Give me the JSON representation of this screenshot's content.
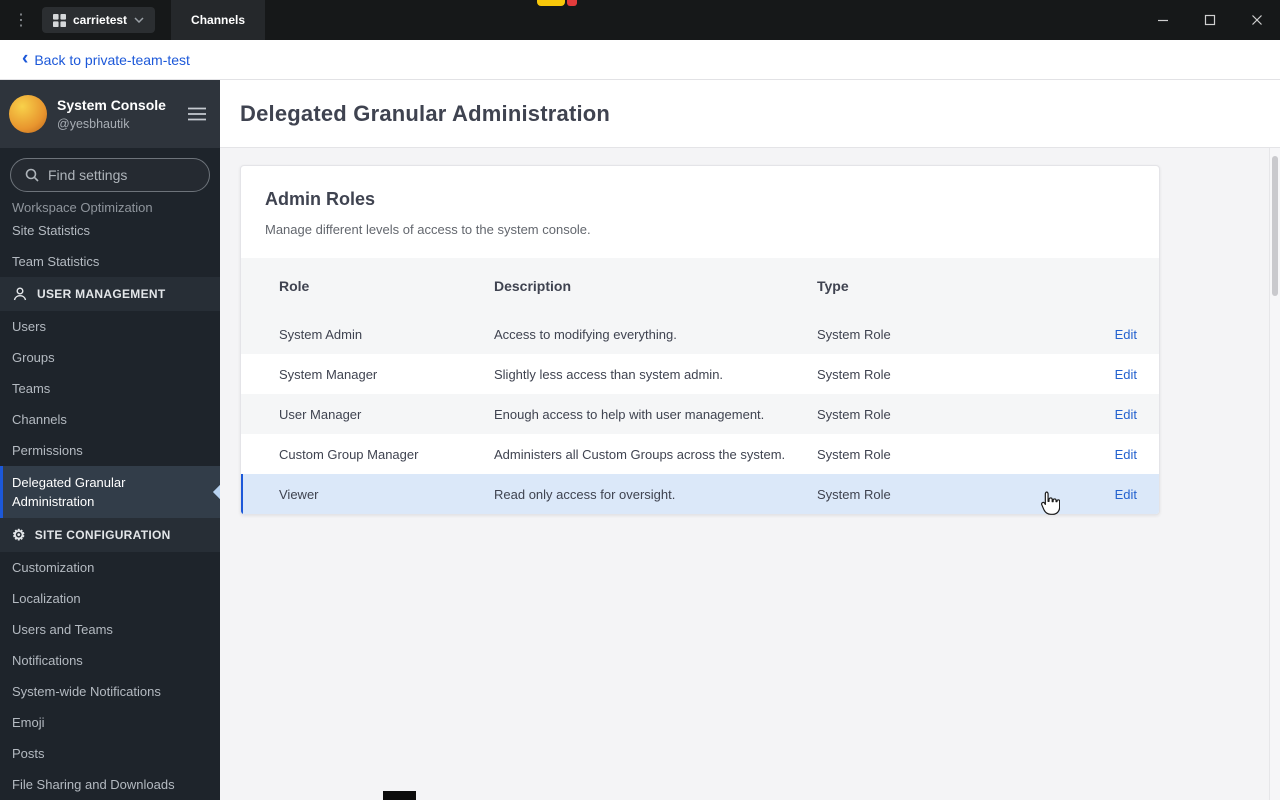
{
  "titlebar": {
    "server_name": "carrietest",
    "tab_label": "Channels"
  },
  "glyphs": {
    "menu_dots": "⋮",
    "back_chevron": "‹",
    "gear": "⚙"
  },
  "icons": [
    "menu-dots-icon",
    "server-grid-icon",
    "chevron-down-icon",
    "minimize-icon",
    "maximize-icon",
    "close-icon",
    "back-chevron-icon",
    "search-icon",
    "hamburger-menu-icon",
    "user-management-icon",
    "site-configuration-gear-icon",
    "active-item-pointer-icon",
    "hand-cursor-icon"
  ],
  "back_bar": {
    "label": "Back to private-team-test"
  },
  "sidebar": {
    "title": "System Console",
    "subtitle": "@yesbhautik",
    "search_placeholder": "Find settings",
    "top_items": [
      "Workspace Optimization",
      "Site Statistics",
      "Team Statistics"
    ],
    "sections": [
      {
        "label": "USER MANAGEMENT",
        "items": [
          "Users",
          "Groups",
          "Teams",
          "Channels",
          "Permissions",
          "Delegated Granular Administration"
        ]
      },
      {
        "label": "SITE CONFIGURATION",
        "items": [
          "Customization",
          "Localization",
          "Users and Teams",
          "Notifications",
          "System-wide Notifications",
          "Emoji",
          "Posts",
          "File Sharing and Downloads"
        ]
      }
    ],
    "active_item": "Delegated Granular Administration"
  },
  "main": {
    "page_title": "Delegated Granular Administration",
    "card": {
      "title": "Admin Roles",
      "subtitle": "Manage different levels of access to the system console.",
      "table": {
        "headers": {
          "role": "Role",
          "description": "Description",
          "type": "Type"
        },
        "edit_label": "Edit",
        "rows": [
          {
            "role": "System Admin",
            "description": "Access to modifying everything.",
            "type": "System Role"
          },
          {
            "role": "System Manager",
            "description": "Slightly less access than system admin.",
            "type": "System Role"
          },
          {
            "role": "User Manager",
            "description": "Enough access to help with user management.",
            "type": "System Role"
          },
          {
            "role": "Custom Group Manager",
            "description": "Administers all Custom Groups across the system.",
            "type": "System Role"
          },
          {
            "role": "Viewer",
            "description": "Read only access for oversight.",
            "type": "System Role"
          }
        ]
      }
    }
  },
  "colors": {
    "accent_blue": "#1c58d9",
    "link_blue": "#2462cf",
    "row_highlight": "#dbe8f9"
  }
}
